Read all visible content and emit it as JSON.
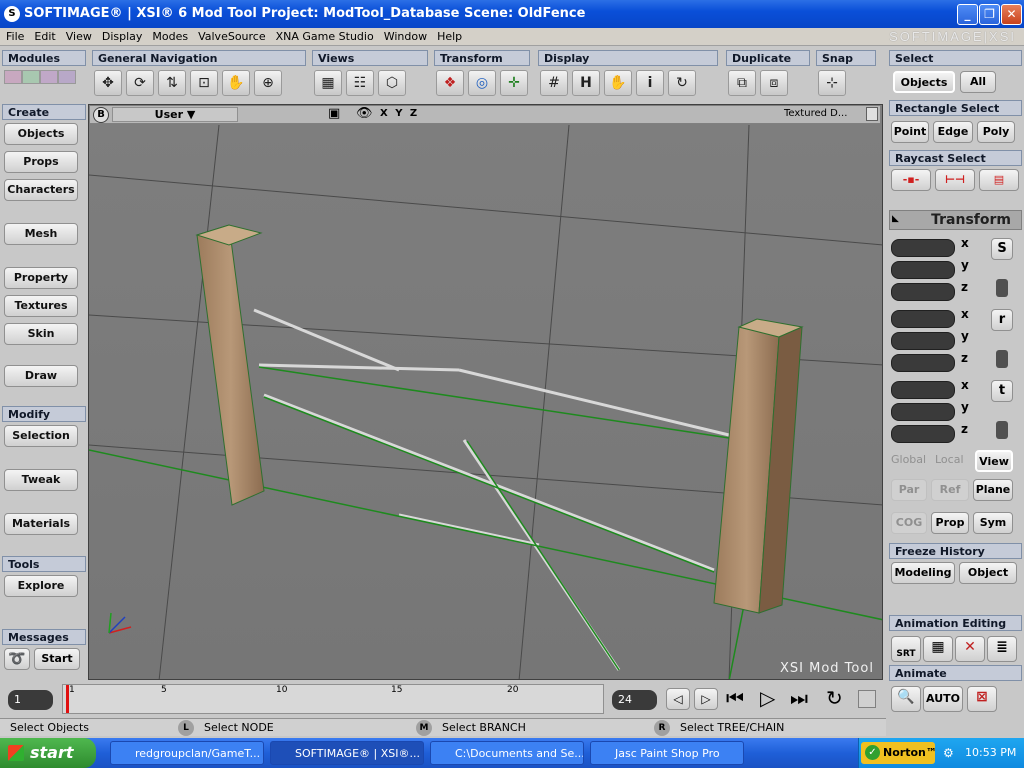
{
  "window": {
    "title": "SOFTIMAGE® | XSI® 6 Mod Tool Project: ModTool_Database     Scene: OldFence",
    "brand": "SOFTIMAGE|XSI"
  },
  "menu": [
    "File",
    "Edit",
    "View",
    "Display",
    "Modes",
    "ValveSource",
    "XNA Game Studio",
    "Window",
    "Help"
  ],
  "toolbar_sections": {
    "modules": "Modules",
    "general_navigation": "General Navigation",
    "views": "Views",
    "transform": "Transform",
    "display": "Display",
    "duplicate": "Duplicate",
    "snap": "Snap",
    "select": "Select"
  },
  "left_panel": {
    "create_header": "Create",
    "create_items": [
      "Objects",
      "Props",
      "Characters",
      "Mesh",
      "Property",
      "Textures",
      "Skin",
      "Draw"
    ],
    "modify_header": "Modify",
    "modify_items": [
      "Selection",
      "Tweak",
      "Materials"
    ],
    "tools_header": "Tools",
    "tools_items": [
      "Explore"
    ],
    "messages_header": "Messages",
    "start_label": "Start"
  },
  "viewport": {
    "camera": "User",
    "badge": "B",
    "axes": "X Y Z",
    "shading": "Textured D...",
    "watermark": "XSI Mod Tool"
  },
  "right_panel": {
    "select_header": "Select",
    "objects": "Objects",
    "all": "All",
    "rect_header": "Rectangle Select",
    "point": "Point",
    "edge": "Edge",
    "poly": "Poly",
    "raycast_header": "Raycast Select",
    "transform_header": "Transform",
    "axes": [
      "x",
      "y",
      "z"
    ],
    "side_buttons": [
      "S",
      "r",
      "t"
    ],
    "global": "Global",
    "local": "Local",
    "view": "View",
    "par": "Par",
    "ref": "Ref",
    "plane": "Plane",
    "cog": "COG",
    "prop": "Prop",
    "sym": "Sym",
    "freeze_header": "Freeze History",
    "modeling": "Modeling",
    "object": "Object",
    "anim_edit_header": "Animation Editing",
    "srt": "SRT",
    "animate_header": "Animate",
    "auto": "AUTO"
  },
  "timeline": {
    "current_frame": "1",
    "end_frame": "24",
    "ticks": [
      "1",
      "5",
      "10",
      "15",
      "20"
    ]
  },
  "status": {
    "left": "Select Objects",
    "l_key": "L",
    "l_text": "Select NODE",
    "m_key": "M",
    "m_text": "Select BRANCH",
    "r_key": "R",
    "r_text": "Select TREE/CHAIN"
  },
  "taskbar": {
    "start": "start",
    "tasks": [
      "redgroupclan/GameT...",
      "SOFTIMAGE® | XSI®...",
      "C:\\Documents and Se...",
      "Jasc Paint Shop Pro"
    ],
    "norton": "Norton™",
    "clock": "10:53 PM"
  }
}
